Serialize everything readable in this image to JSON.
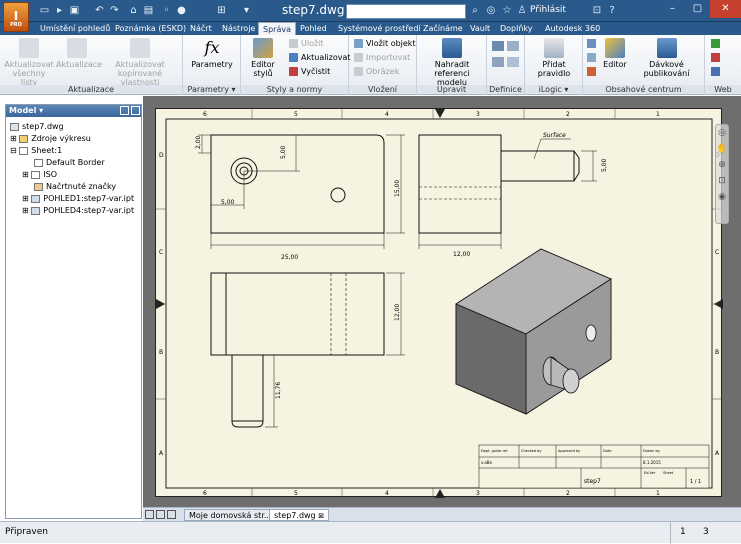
{
  "app": {
    "logo": "I",
    "logo_sub": "PRO",
    "doc_title": "step7.dwg",
    "signin": "Přihlásit",
    "search": {
      "value": ""
    }
  },
  "tabs": [
    "Umístění pohledů",
    "Poznámka (ESKD)",
    "Náčrt",
    "Nástroje",
    "Správa",
    "Pohled",
    "Systémové prostředí",
    "Začínáme",
    "Vault",
    "Doplňky",
    "Autodesk 360"
  ],
  "active_tab": "Správa",
  "ribbon": {
    "aktualizace": {
      "name": "Aktualizace",
      "b1": "Aktualizovat všechny listy",
      "b2": "Aktualizace",
      "b3": "Aktualizovat kopírované vlastnosti"
    },
    "parametry": {
      "name": "Parametry ▾",
      "b1": "Parametry"
    },
    "styly": {
      "name": "Styly a normy",
      "b1": "Editor stylů",
      "s1": "Uložit",
      "s2": "Aktualizovat",
      "s3": "Vyčistit"
    },
    "vlozeni": {
      "name": "Vložení",
      "s1": "Vložit objekt",
      "s2": "Importovat",
      "s3": "Obrázek"
    },
    "upravit": {
      "name": "Upravit",
      "b1": "Nahradit referenci modelu"
    },
    "definice": {
      "name": "Definice"
    },
    "ilogic": {
      "name": "iLogic ▾",
      "b1": "Přidat pravidlo"
    },
    "obsahove": {
      "name": "Obsahové centrum",
      "b1": "Editor",
      "b2": "Dávkové publikování"
    },
    "web": {
      "name": "Web"
    }
  },
  "browser": {
    "title": "Model ▾",
    "items": [
      "step7.dwg",
      "Zdroje výkresu",
      "Sheet:1",
      "Default Border",
      "ISO",
      "Načrtnuté značky",
      "POHLED1:step7-var.ipt",
      "POHLED4:step7-var.ipt"
    ]
  },
  "drawing": {
    "zones_top": [
      "6",
      "5",
      "4",
      "3",
      "2",
      "1"
    ],
    "zones_side": [
      "D",
      "C",
      "B",
      "A"
    ],
    "dims": {
      "d1": "2,00",
      "d2": "5,00",
      "d3": "5,00",
      "d4": "25,00",
      "d5": "15,00",
      "d6": "12,00",
      "d7": "5,00",
      "d8": "12,00",
      "d9": "11,76"
    },
    "leader": "Surface",
    "title_block": {
      "h1": "Dept. guide ref.",
      "h2": "Checked by",
      "h3": "Approved by",
      "h4": "Date",
      "h5": "Drawn by",
      "h6": "Edition",
      "name_val": "step7",
      "date_val": "8.1.2015",
      "creator": "v.aBe",
      "sheet": "1 / 1",
      "sheet_lbl": "Sheet",
      "edition_lbl": "Ed.Ver"
    }
  },
  "doc_tabs": [
    "Moje domovská str...",
    "step7.dwg"
  ],
  "status": {
    "text": "Připraven",
    "n1": "1",
    "n2": "3"
  }
}
